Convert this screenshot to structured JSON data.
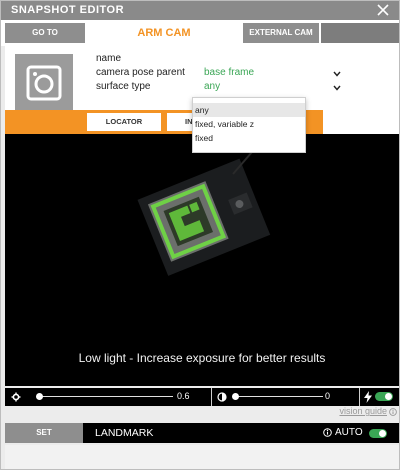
{
  "window": {
    "title": "SNAPSHOT EDITOR",
    "close_icon": "close-icon"
  },
  "tabs": {
    "goto": "GO TO",
    "arm_cam": "ARM CAM",
    "external_cam": "EXTERNAL CAM"
  },
  "header": {
    "icon": "camera-icon",
    "name_label": "name",
    "camera_pose_parent_label": "camera pose parent",
    "camera_pose_parent_value": "base frame",
    "surface_type_label": "surface type",
    "surface_type_value": "any"
  },
  "subtabs": {
    "locator": "LOCATOR",
    "ins": "INS"
  },
  "dropdown": {
    "options": [
      "any",
      "fixed, variable z",
      "fixed"
    ],
    "selected": "any"
  },
  "camera_view": {
    "message": "Low light - Increase exposure for better results"
  },
  "controls": {
    "focus_icon": "gear-icon",
    "focus_value": "0.6",
    "focus_fraction": 0.0,
    "contrast_icon": "contrast-icon",
    "contrast_value": "0",
    "contrast_fraction": 0.0,
    "flash_icon": "flash-icon",
    "flash_on": true,
    "vision_guide": "vision guide"
  },
  "bottom": {
    "set_label": "SET",
    "landmark_label": "LANDMARK",
    "auto_label": "AUTO",
    "auto_on": true
  },
  "colors": {
    "accent": "#f39324",
    "green": "#3aa655",
    "title_bar": "#8a8a8a"
  }
}
